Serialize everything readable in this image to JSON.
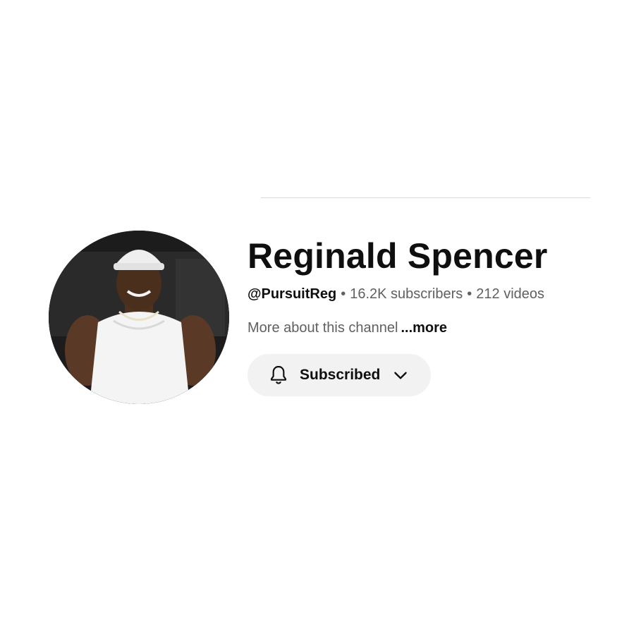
{
  "channel": {
    "name": "Reginald Spencer",
    "handle": "@PursuitReg",
    "separator": "•",
    "subscribers": "16.2K subscribers",
    "videos": "212 videos",
    "description": "More about this channel",
    "more_link": "...more"
  },
  "subscribe_button": {
    "label": "Subscribed",
    "icon": "bell-icon",
    "dropdown_icon": "chevron-down-icon"
  },
  "colors": {
    "text_primary": "#0f0f0f",
    "text_secondary": "#606060",
    "button_bg": "#f2f2f2"
  }
}
